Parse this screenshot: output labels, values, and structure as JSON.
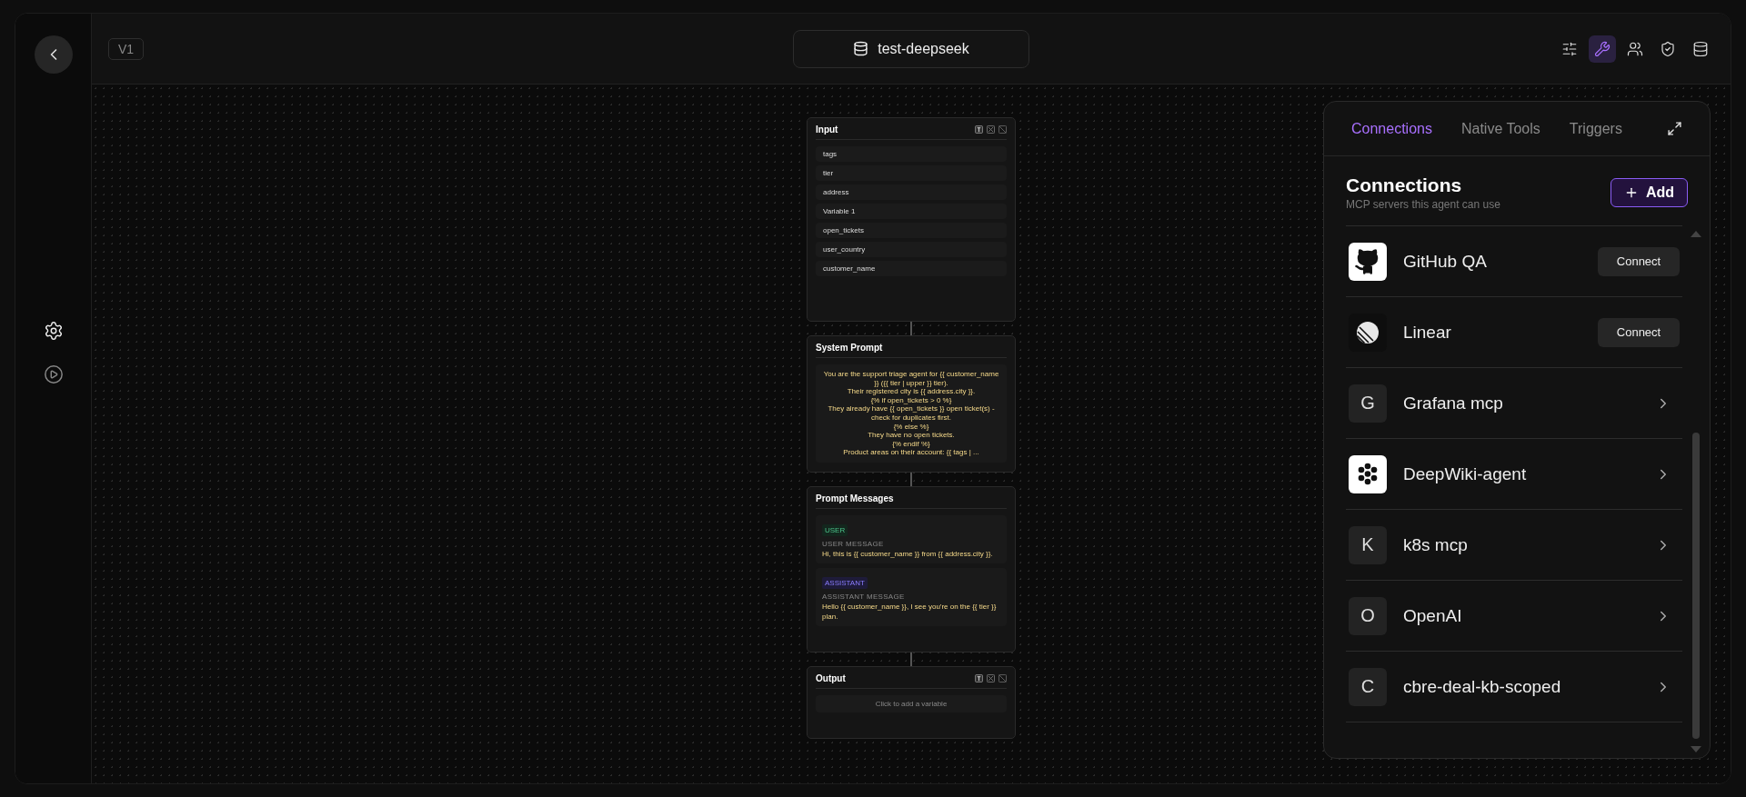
{
  "sidebar": {
    "items": [
      {
        "kind": "settings",
        "selected": false
      },
      {
        "kind": "play",
        "selected": false
      }
    ]
  },
  "header": {
    "version": "V1",
    "project": "test-deepseek",
    "tools": [
      {
        "kind": "sliders",
        "selected": false
      },
      {
        "kind": "wrench",
        "selected": true
      },
      {
        "kind": "users",
        "selected": false
      },
      {
        "kind": "shield",
        "selected": false
      },
      {
        "kind": "database",
        "selected": false
      }
    ]
  },
  "nodes": [
    {
      "kind": "variables",
      "title": "Input",
      "variables": [
        "tags",
        "tier",
        "address",
        "Variable 1",
        "open_tickets",
        "user_country",
        "customer_name"
      ]
    },
    {
      "kind": "prompt",
      "title": "System Prompt",
      "text": "You are the support triage agent for {{ customer_name }} ({{ tier | upper }} tier).\nTheir registered city is {{ address.city }}.\n{% if open_tickets > 0 %}\nThey already have {{ open_tickets }} open ticket(s) - check for duplicates first.\n{% else %}\nThey have no open tickets.\n{% endif %}\nProduct areas on their account: {{ tags | ..."
    },
    {
      "kind": "messages",
      "title": "Prompt Messages",
      "messages": [
        {
          "kind": "user",
          "badge": "USER",
          "label": "USER MESSAGE",
          "text": "Hi, this is {{ customer_name }} from {{ address.city }}."
        },
        {
          "kind": "assistant",
          "badge": "ASSISTANT",
          "label": "ASSISTANT MESSAGE",
          "text": "Hello {{ customer_name }}, I see you're on the {{ tier }} plan."
        }
      ]
    },
    {
      "kind": "output",
      "title": "Output",
      "placeholder": "Click to add a variable"
    }
  ],
  "panel": {
    "tabs": [
      {
        "label": "Connections",
        "selected": true
      },
      {
        "label": "Native Tools",
        "selected": false
      },
      {
        "label": "Triggers",
        "selected": false
      }
    ],
    "title": "Connections",
    "subtitle": "MCP servers this agent can use",
    "add_button": "Add",
    "connections": [
      {
        "name": "GitHub QA",
        "kind": "github",
        "action": "Connect"
      },
      {
        "name": "Linear",
        "kind": "linear",
        "action": "Connect"
      },
      {
        "name": "Grafana mcp",
        "kind": "letter",
        "letter": "G"
      },
      {
        "name": "DeepWiki-agent",
        "kind": "deepwiki"
      },
      {
        "name": "k8s mcp",
        "kind": "letter",
        "letter": "K"
      },
      {
        "name": "OpenAI",
        "kind": "letter",
        "letter": "O"
      },
      {
        "name": "cbre-deal-kb-scoped",
        "kind": "letter",
        "letter": "C"
      }
    ]
  }
}
